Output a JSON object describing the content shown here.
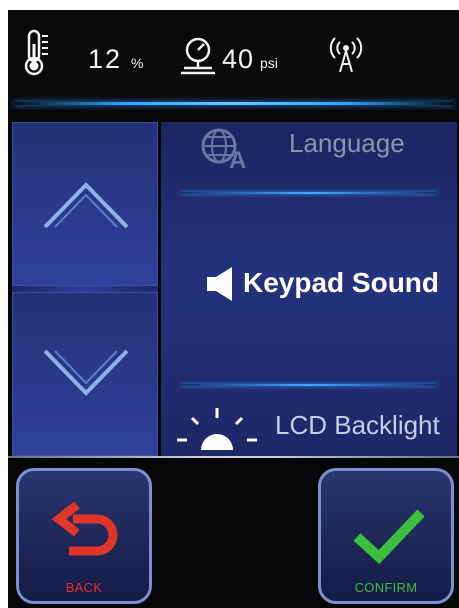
{
  "status": {
    "humidity_value": "12",
    "humidity_unit": "%",
    "pressure_value": "40",
    "pressure_unit": "psi",
    "icons": [
      "thermometer-icon",
      "pressure-gauge-icon",
      "wireless-signal-icon"
    ]
  },
  "navigation": {
    "up_icon": "chevron-up-icon",
    "down_icon": "chevron-down-icon"
  },
  "menu": {
    "items": [
      {
        "label": "Language",
        "icon": "globe-language-icon",
        "state": "dimmed"
      },
      {
        "label": "Keypad Sound",
        "icon": "speaker-icon",
        "state": "selected"
      },
      {
        "label": "LCD Backlight",
        "icon": "sun-backlight-icon",
        "state": "dimmed"
      }
    ]
  },
  "actions": {
    "back_label": "BACK",
    "confirm_label": "CONFIRM"
  },
  "colors": {
    "background": "#050608",
    "panel_blue": "#26327e",
    "accent_glow": "#2fa4ff",
    "back_red": "#e0362a",
    "confirm_green": "#3cbf3c",
    "button_border": "#7e8fcf"
  }
}
